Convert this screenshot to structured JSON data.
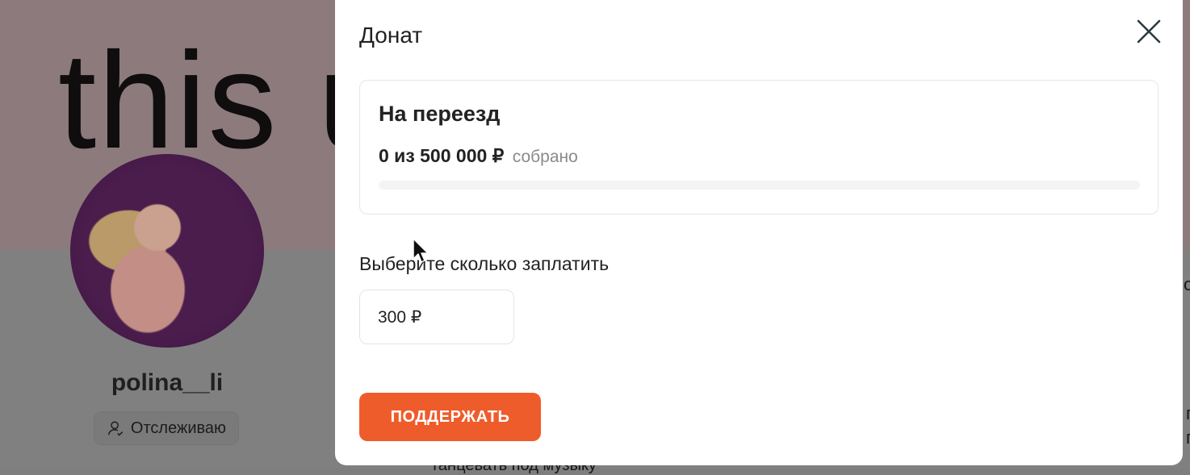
{
  "background": {
    "cover_text": "this u",
    "username": "polina__li",
    "follow_label": "Отслеживаю",
    "right_fragment_1": "о",
    "right_fragment_2": "п",
    "right_fragment_3": "п",
    "bottom_fragment": "танцевать под музыку"
  },
  "modal": {
    "title": "Донат",
    "goal": {
      "title": "На переезд",
      "progress_amount": "0 из 500 000 ₽",
      "progress_suffix": "собрано",
      "progress_fraction": 0
    },
    "choose_label": "Выберите сколько заплатить",
    "amount_value": "300 ₽",
    "submit_label": "ПОДДЕРЖАТЬ"
  },
  "colors": {
    "accent": "#ef5c2b",
    "overlay": "#808080"
  },
  "icons": {
    "close": "close-icon",
    "follow": "user-icon",
    "cursor": "mouse-pointer-icon"
  }
}
